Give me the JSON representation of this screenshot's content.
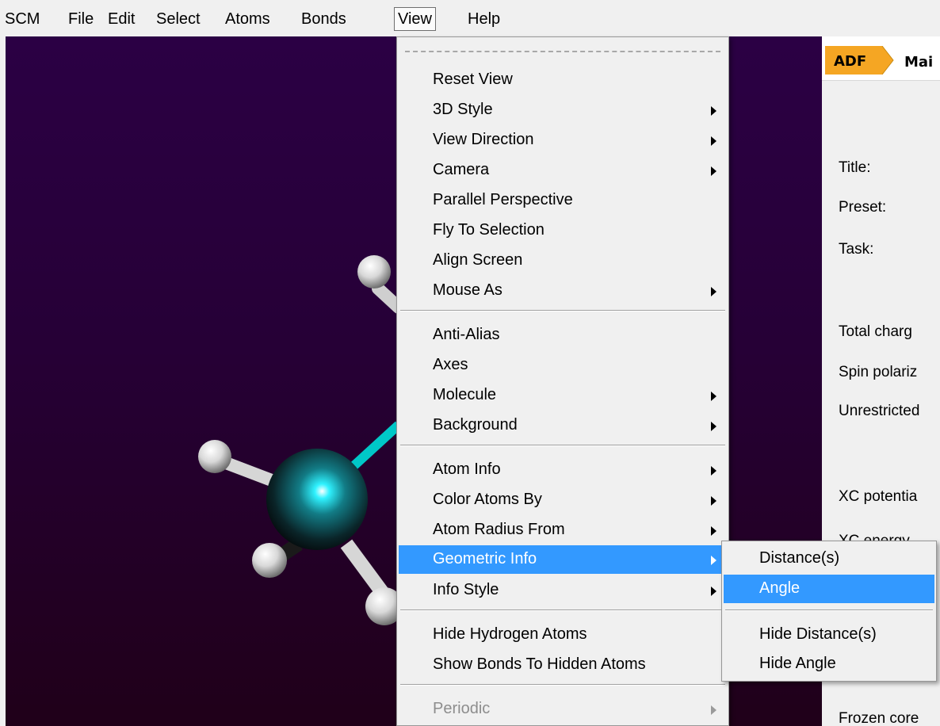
{
  "menubar": {
    "items": [
      "SCM",
      "File",
      "Edit",
      "Select",
      "Atoms",
      "Bonds",
      "View",
      "Help"
    ],
    "active": "View"
  },
  "view_menu": {
    "items": [
      {
        "label": "Reset View",
        "submenu": false
      },
      {
        "label": "3D Style",
        "submenu": true
      },
      {
        "label": "View Direction",
        "submenu": true
      },
      {
        "label": "Camera",
        "submenu": true
      },
      {
        "label": "Parallel Perspective",
        "submenu": false
      },
      {
        "label": "Fly To Selection",
        "submenu": false
      },
      {
        "label": "Align Screen",
        "submenu": false
      },
      {
        "label": "Mouse As",
        "submenu": true
      },
      {
        "label": "Anti-Alias",
        "submenu": false
      },
      {
        "label": "Axes",
        "submenu": false
      },
      {
        "label": "Molecule",
        "submenu": true
      },
      {
        "label": "Background",
        "submenu": true
      },
      {
        "label": "Atom Info",
        "submenu": true
      },
      {
        "label": "Color Atoms By",
        "submenu": true
      },
      {
        "label": "Atom Radius From",
        "submenu": true
      },
      {
        "label": "Geometric Info",
        "submenu": true,
        "highlighted": true
      },
      {
        "label": "Info Style",
        "submenu": true
      },
      {
        "label": "Hide Hydrogen Atoms",
        "submenu": false
      },
      {
        "label": "Show Bonds To Hidden Atoms",
        "submenu": false
      },
      {
        "label": "Periodic",
        "submenu": true,
        "disabled": true
      }
    ]
  },
  "geometric_info_submenu": {
    "items": [
      {
        "label": "Distance(s)"
      },
      {
        "label": "Angle",
        "highlighted": true
      },
      {
        "label": "Hide Distance(s)"
      },
      {
        "label": "Hide Angle"
      }
    ]
  },
  "right_panel": {
    "tabs": [
      "ADF",
      "Mai"
    ],
    "labels": [
      "Title:",
      "Preset:",
      "Task:",
      "Total charg",
      "Spin polariz",
      "Unrestricted",
      "XC potentia",
      "XC energy",
      "Frozen core"
    ]
  },
  "colors": {
    "highlight": "#3399ff",
    "adf_tab": "#f5a623",
    "bond_cyan": "#00c8c8",
    "background_top": "#2b0044",
    "background_bottom": "#200019"
  },
  "icons": [
    "submenu-arrow-icon",
    "molecule-viewer"
  ]
}
